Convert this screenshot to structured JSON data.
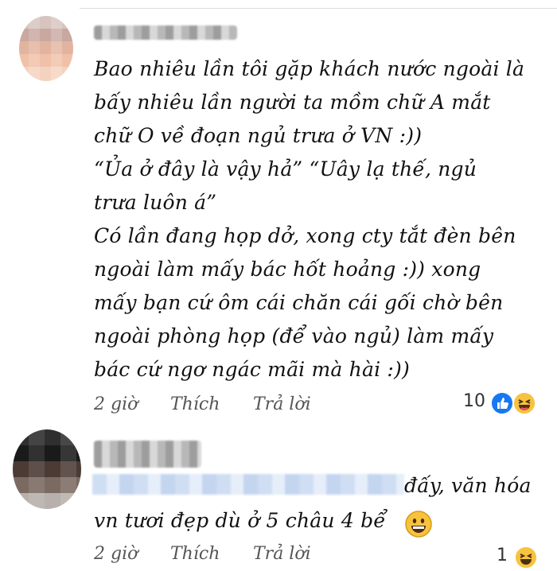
{
  "comments": [
    {
      "text": "Bao nhiêu lần tôi gặp khách nước ngoài là\nbấy nhiêu lần người ta mồm chữ A mắt\nchữ O về đoạn ngủ trưa ở VN :))\n“Ủa ở đây là vậy hả” “Uây lạ thế, ngủ\ntrưa luôn á”\nCó lần đang họp dở, xong cty tắt đèn bên\nngoài làm mấy bác hốt hoảng :)) xong\nmấy bạn cứ ôm cái chăn cái gối chờ bên\nngoài phòng họp (để vào ngủ) làm mấy\nbác cứ ngơ ngác mãi mà hài :))",
      "time": "2 giờ",
      "like_label": "Thích",
      "reply_label": "Trả lời",
      "reaction_count": "10",
      "reactions": [
        "like-icon",
        "haha-icon"
      ]
    },
    {
      "text_line1_tail": "đấy, văn hóa",
      "text_line2": "vn tươi đẹp dù ở 5 châu 4 bể",
      "emoji": "grinning-face-icon",
      "time": "2 giờ",
      "like_label": "Thích",
      "reply_label": "Trả lời",
      "reaction_count": "1",
      "reactions": [
        "haha-icon"
      ]
    }
  ],
  "colors": {
    "like_blue": "#1877f2",
    "haha_yellow": "#f7c33f",
    "action_gray": "#555555",
    "divider": "#dadde1"
  }
}
